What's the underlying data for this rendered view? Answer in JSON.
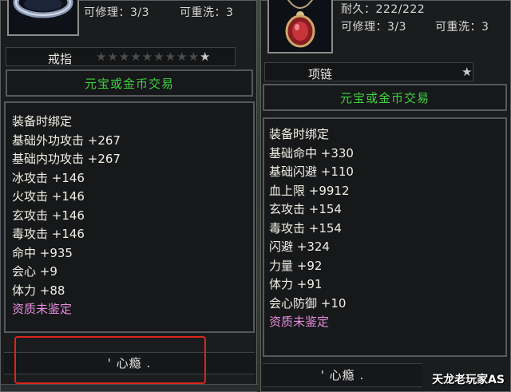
{
  "left": {
    "item_icon": "ring-icon",
    "stats": {
      "repair": "可修理：3/3",
      "rewash": "可重洗：3"
    },
    "name": "戒指",
    "stars_dim": "★★★★★★★★★",
    "stars_lit": "★",
    "trade": "元宝或金币交易",
    "attributes": [
      "装备时绑定",
      "基础外功攻击 +267",
      "基础内功攻击 +267",
      "冰攻击 +146",
      "火攻击 +146",
      "玄攻击 +146",
      "毒攻击 +146",
      "命中 +935",
      "会心 +9",
      "体力 +88"
    ],
    "unidentified": "资质未鉴定",
    "footer": "' 心瘾 ."
  },
  "right": {
    "item_icon": "necklace-icon",
    "stats": {
      "durability": "耐久：222/222",
      "repair": "可修理：3/3",
      "rewash": "可重洗：3"
    },
    "name": "项链",
    "stars_lit": "★",
    "trade": "元宝或金币交易",
    "attributes": [
      "装备时绑定",
      "基础命中 +330",
      "基础闪避 +110",
      "血上限 +9912",
      "玄攻击 +154",
      "毒攻击 +154",
      "闪避 +324",
      "力量 +92",
      "体力 +91",
      "会心防御 +10"
    ],
    "unidentified": "资质未鉴定",
    "footer": "' 心瘾 ."
  },
  "watermark": "天龙老玩家AS",
  "colors": {
    "trade_green": "#3ed23e",
    "unidentified_pink": "#e88de0",
    "highlight_red": "#d9261c"
  }
}
